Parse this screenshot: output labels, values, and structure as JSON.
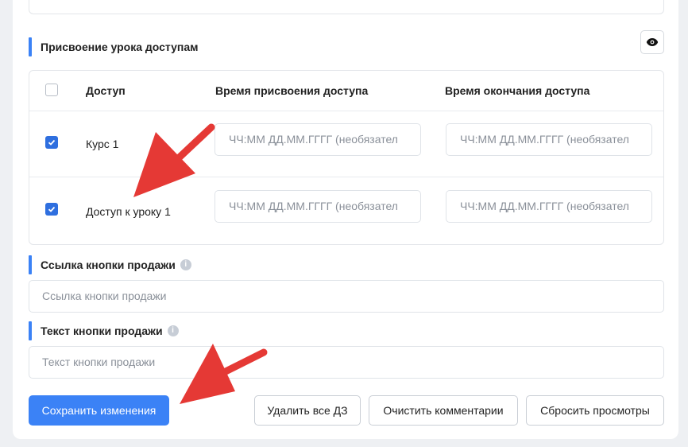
{
  "access_section": {
    "title": "Присвоение урока доступам",
    "columns": [
      "Доступ",
      "Время присвоения доступа",
      "Время окончания доступа"
    ],
    "rows": [
      {
        "name": "Курс 1",
        "checked": true,
        "start_placeholder": "ЧЧ:ММ ДД.ММ.ГГГГ (необязател",
        "end_placeholder": "ЧЧ:ММ ДД.ММ.ГГГГ (необязател"
      },
      {
        "name": "Доступ к уроку 1",
        "checked": true,
        "start_placeholder": "ЧЧ:ММ ДД.ММ.ГГГГ (необязател",
        "end_placeholder": "ЧЧ:ММ ДД.ММ.ГГГГ (необязател"
      }
    ]
  },
  "sale_link": {
    "label": "Ссылка кнопки продажи",
    "placeholder": "Ссылка кнопки продажи"
  },
  "sale_text": {
    "label": "Текст кнопки продажи",
    "placeholder": "Текст кнопки продажи"
  },
  "buttons": {
    "save": "Сохранить изменения",
    "delete_hw": "Удалить все ДЗ",
    "clear_comments": "Очистить комментарии",
    "reset_views": "Сбросить просмотры"
  },
  "colors": {
    "accent": "#3b82f6",
    "annotation_arrow": "#e53935"
  },
  "icons": {
    "preview": "eye-icon",
    "info": "info-icon",
    "checkbox": "checkmark-icon"
  }
}
